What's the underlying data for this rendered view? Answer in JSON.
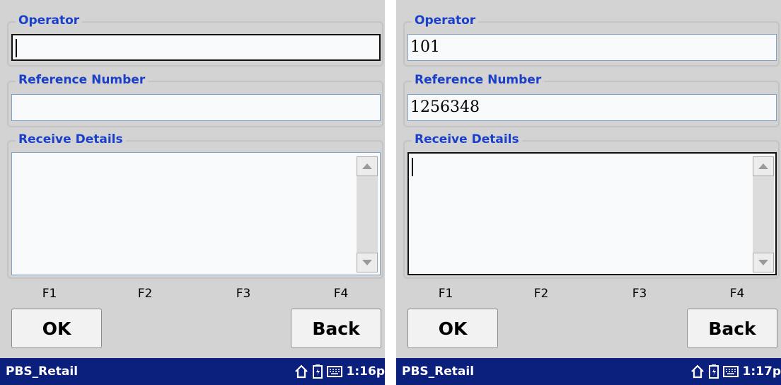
{
  "screens": [
    {
      "operator": {
        "label": "Operator",
        "value": ""
      },
      "reference": {
        "label": "Reference Number",
        "value": ""
      },
      "receive": {
        "label": "Receive Details",
        "value": ""
      },
      "fkeys": [
        "F1",
        "F2",
        "F3",
        "F4"
      ],
      "buttons": {
        "ok": "OK",
        "back": "Back"
      },
      "taskbar": {
        "app": "PBS_Retail",
        "time": "1:16p"
      },
      "focus": "operator"
    },
    {
      "operator": {
        "label": "Operator",
        "value": "101"
      },
      "reference": {
        "label": "Reference Number",
        "value": "1256348"
      },
      "receive": {
        "label": "Receive Details",
        "value": ""
      },
      "fkeys": [
        "F1",
        "F2",
        "F3",
        "F4"
      ],
      "buttons": {
        "ok": "OK",
        "back": "Back"
      },
      "taskbar": {
        "app": "PBS_Retail",
        "time": "1:17p"
      },
      "focus": "receive"
    }
  ],
  "icons": {
    "home": "home-icon",
    "battery": "battery-icon",
    "keyboard": "keyboard-icon"
  },
  "colors": {
    "label": "#1a3fc8",
    "taskbar": "#0b1f7d",
    "background": "#d3d3d3"
  }
}
